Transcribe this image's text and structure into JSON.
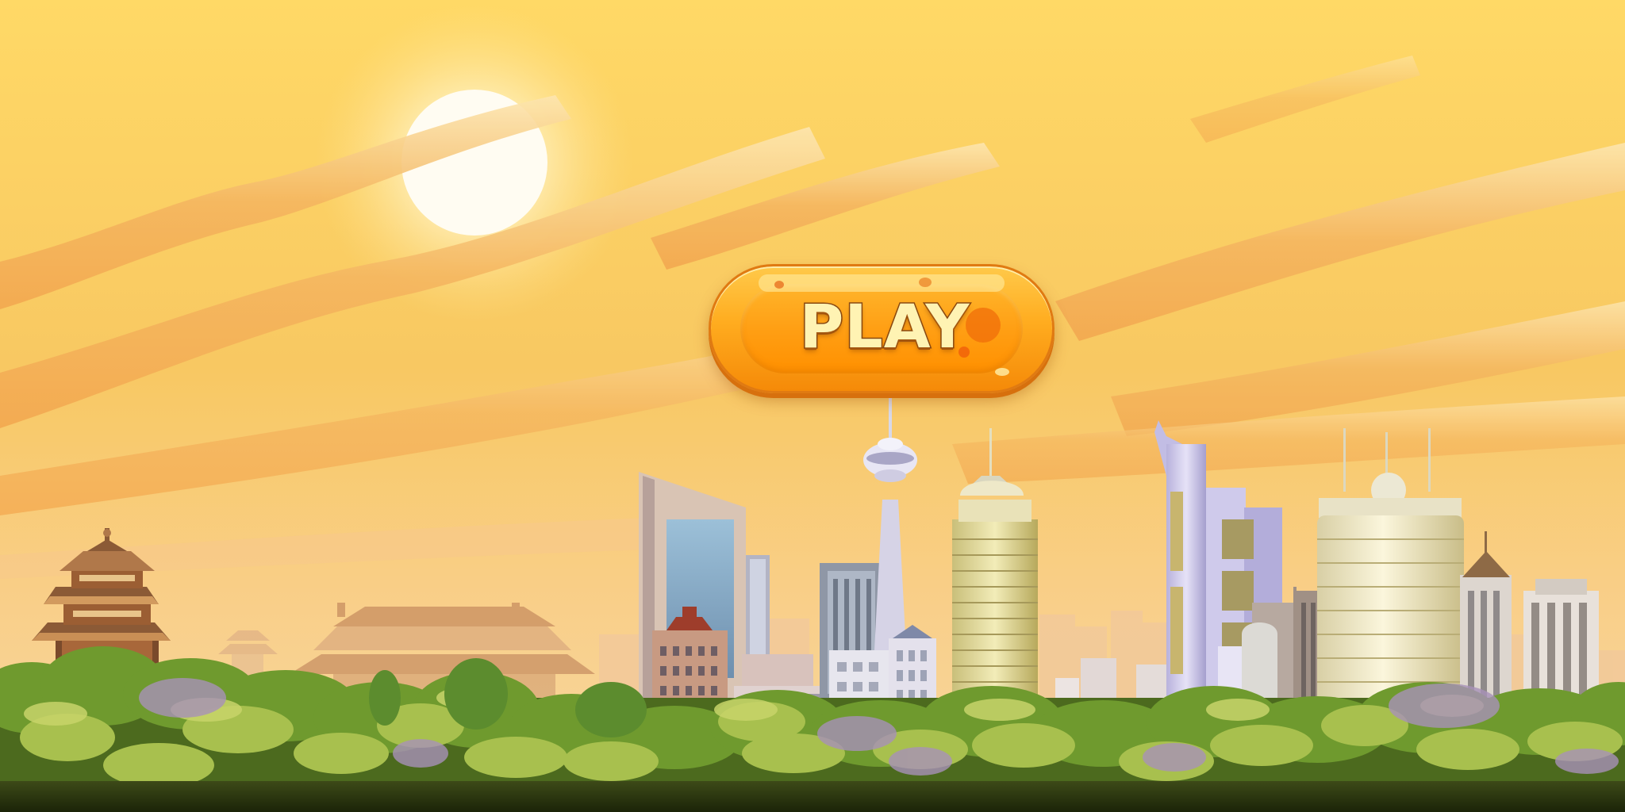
{
  "screen": {
    "name": "title-screen"
  },
  "play_button": {
    "label": "PLAY",
    "fill_color": "#ff9f14",
    "text_color": "#fff3b3",
    "outline_color": "#e07a12"
  },
  "palette": {
    "sky": "#f7cf6a",
    "sun": "#fffaf0",
    "cloud": "#f5b25c",
    "foliage": "#7ca63a",
    "ground": "#1f2a0e"
  },
  "scene": {
    "landmarks": [
      "pagoda",
      "temple",
      "tv-tower",
      "skyscrapers",
      "trees"
    ]
  }
}
